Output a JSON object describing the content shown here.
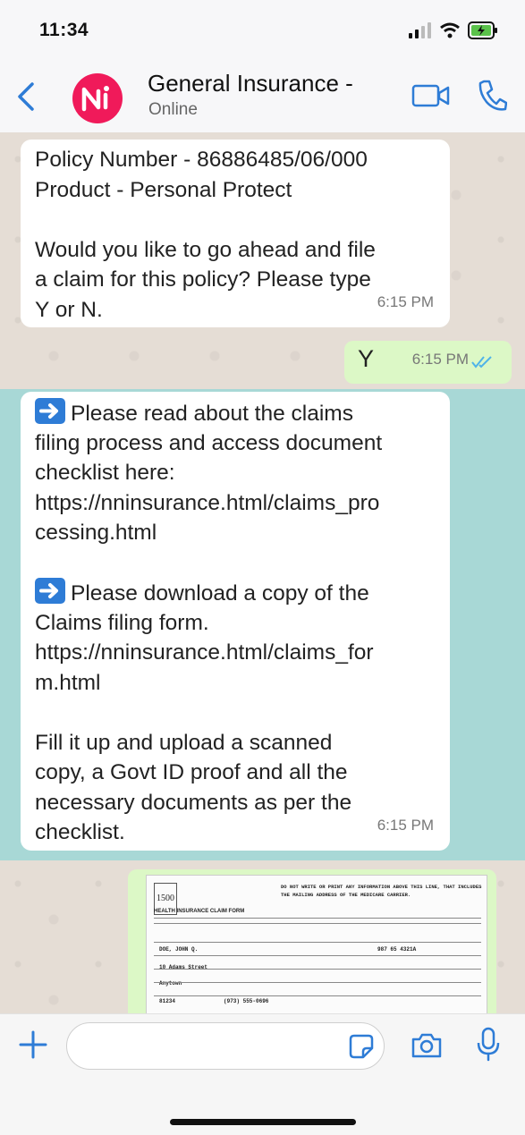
{
  "status_bar": {
    "time": "11:34"
  },
  "header": {
    "title": "General Insurance -",
    "subtitle": "Online"
  },
  "messages": {
    "m1": {
      "lines": [
        "Policy Number -  86886485/06/000",
        "Product - Personal Protect"
      ],
      "lines2": [
        "Would you like to go ahead and file",
        "a claim for this policy? Please type",
        "Y or N."
      ],
      "time": "6:15 PM"
    },
    "m2": {
      "text": "Y",
      "time": "6:15 PM"
    },
    "m3": {
      "p1": [
        "Please read about the claims",
        "filing process and access document",
        "checklist here:",
        "https://nninsurance.html/claims_pro",
        "cessing.html"
      ],
      "p2": [
        "Please download a copy of the",
        "Claims filing form.",
        "https://nninsurance.html/claims_for",
        "m.html"
      ],
      "p3": [
        "Fill it up and upload a scanned",
        "copy, a Govt ID proof and all the",
        "necessary documents as per the",
        "checklist."
      ],
      "time": "6:15 PM"
    },
    "m4": {
      "form_number": "1500",
      "form_title": "HEALTH INSURANCE CLAIM FORM",
      "notice": "DO NOT WRITE OR PRINT ANY INFORMATION ABOVE THIS LINE, THAT INCLUDES THE MAILING ADDRESS OF THE MEDICARE CARRIER.",
      "fields": [
        "DOE, JOHN Q.",
        "10 Adams Street",
        "Anytown",
        "81234",
        "(973) 555-0696",
        "987 65 4321A"
      ]
    }
  },
  "icons": [
    "back-icon",
    "video-icon",
    "phone-icon",
    "plus-icon",
    "sticker-icon",
    "camera-icon",
    "mic-icon",
    "arrow-right-icon",
    "double-check-icon"
  ],
  "colors": {
    "accent": "#2e7cd6",
    "avatar": "#f01a5a",
    "outgoing": "#dcf8c6",
    "highlight": "#a8d8d6",
    "chat_bg": "#e5ddd5"
  }
}
